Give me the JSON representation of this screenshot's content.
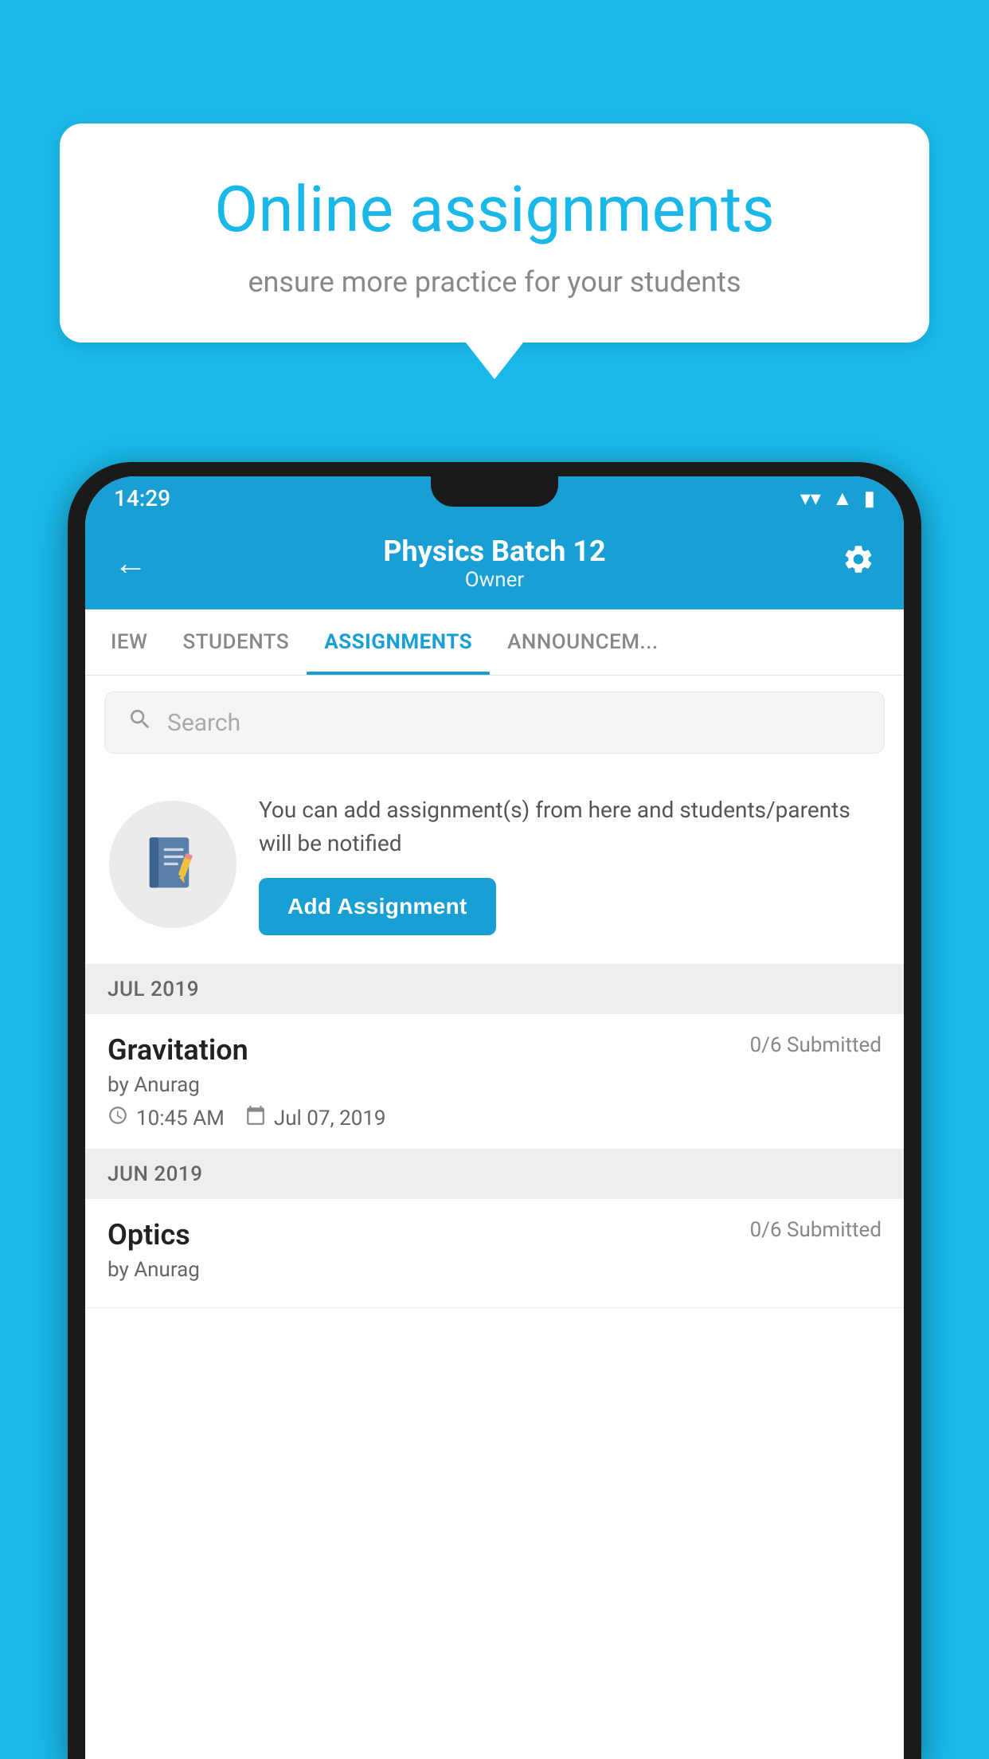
{
  "background_color": "#1ab8e8",
  "speech_bubble": {
    "title": "Online assignments",
    "subtitle": "ensure more practice for your students"
  },
  "status_bar": {
    "time": "14:29",
    "wifi": "▼",
    "signal": "◀",
    "battery": "▮"
  },
  "header": {
    "title": "Physics Batch 12",
    "subtitle": "Owner",
    "back_label": "←",
    "settings_label": "⚙"
  },
  "tabs": [
    {
      "label": "IEW",
      "active": false
    },
    {
      "label": "STUDENTS",
      "active": false
    },
    {
      "label": "ASSIGNMENTS",
      "active": true
    },
    {
      "label": "ANNOUNCEM...",
      "active": false
    }
  ],
  "search": {
    "placeholder": "Search"
  },
  "promo": {
    "text": "You can add assignment(s) from here and students/parents will be notified",
    "button_label": "Add Assignment"
  },
  "sections": [
    {
      "month_label": "JUL 2019",
      "assignments": [
        {
          "name": "Gravitation",
          "submitted": "0/6 Submitted",
          "by": "by Anurag",
          "time": "10:45 AM",
          "date": "Jul 07, 2019"
        }
      ]
    },
    {
      "month_label": "JUN 2019",
      "assignments": [
        {
          "name": "Optics",
          "submitted": "0/6 Submitted",
          "by": "by Anurag",
          "time": "",
          "date": ""
        }
      ]
    }
  ]
}
